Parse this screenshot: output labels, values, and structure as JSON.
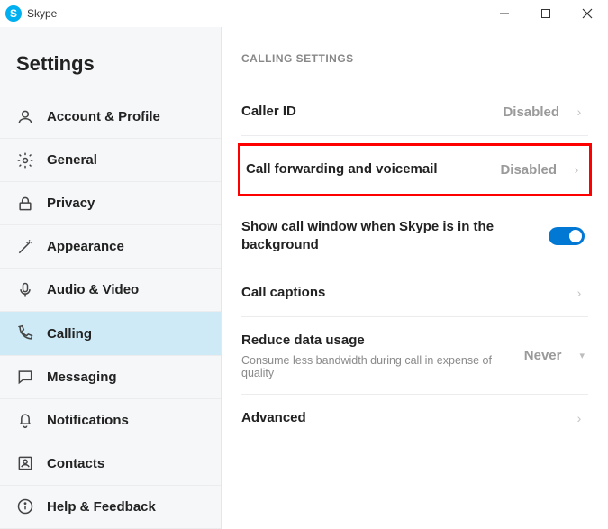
{
  "app": {
    "name": "Skype"
  },
  "sidebar": {
    "title": "Settings",
    "items": [
      {
        "id": "account",
        "label": "Account & Profile"
      },
      {
        "id": "general",
        "label": "General"
      },
      {
        "id": "privacy",
        "label": "Privacy"
      },
      {
        "id": "appearance",
        "label": "Appearance"
      },
      {
        "id": "audio",
        "label": "Audio & Video"
      },
      {
        "id": "calling",
        "label": "Calling",
        "active": true
      },
      {
        "id": "messaging",
        "label": "Messaging"
      },
      {
        "id": "notifications",
        "label": "Notifications"
      },
      {
        "id": "contacts",
        "label": "Contacts"
      },
      {
        "id": "help",
        "label": "Help & Feedback"
      }
    ]
  },
  "content": {
    "section_header": "CALLING SETTINGS",
    "rows": {
      "caller_id": {
        "label": "Caller ID",
        "value": "Disabled"
      },
      "forwarding": {
        "label": "Call forwarding and voicemail",
        "value": "Disabled",
        "highlighted": true
      },
      "show_window": {
        "label": "Show call window when Skype is in the background",
        "toggle": true
      },
      "captions": {
        "label": "Call captions"
      },
      "reduce_data": {
        "label": "Reduce data usage",
        "value": "Never",
        "sublabel": "Consume less bandwidth during call in expense of quality"
      },
      "advanced": {
        "label": "Advanced"
      }
    }
  }
}
